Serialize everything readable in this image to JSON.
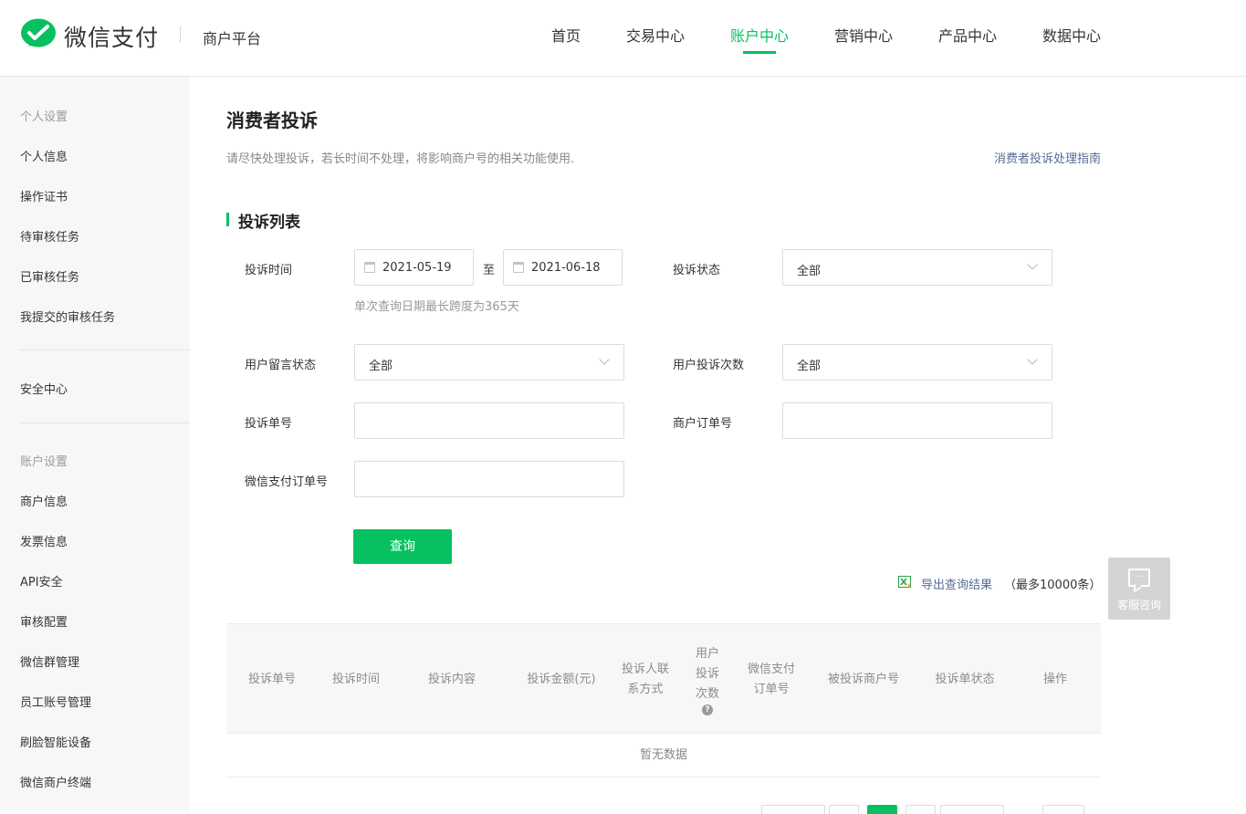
{
  "brand": {
    "name": "微信支付",
    "platform": "商户平台",
    "color": "#07c160"
  },
  "nav": {
    "items": [
      "首页",
      "交易中心",
      "账户中心",
      "营销中心",
      "产品中心",
      "数据中心"
    ],
    "active": "账户中心"
  },
  "sidebar": {
    "group_personal": "个人设置",
    "personal_items": [
      "个人信息",
      "操作证书",
      "待审核任务",
      "已审核任务",
      "我提交的审核任务"
    ],
    "security": "安全中心",
    "group_account": "账户设置",
    "account_items": [
      "商户信息",
      "发票信息",
      "API安全",
      "审核配置",
      "微信群管理",
      "员工账号管理",
      "刷脸智能设备",
      "微信商户终端"
    ]
  },
  "page": {
    "title": "消费者投诉",
    "description": "请尽快处理投诉，若长时间不处理，将影响商户号的相关功能使用.",
    "guide_link": "消费者投诉处理指南"
  },
  "filters": {
    "section_title": "投诉列表",
    "time_label": "投诉时间",
    "start_date": "2021-05-19",
    "to_label": "至",
    "end_date": "2021-06-18",
    "date_hint": "单次查询日期最长跨度为365天",
    "status_label": "投诉状态",
    "status_value": "全部",
    "message_status_label": "用户留言状态",
    "message_status_value": "全部",
    "complaint_count_label": "用户投诉次数",
    "complaint_count_value": "全部",
    "complaint_no_label": "投诉单号",
    "complaint_no_value": "",
    "merchant_order_label": "商户订单号",
    "merchant_order_value": "",
    "wxpay_order_label": "微信支付订单号",
    "wxpay_order_value": "",
    "query_button": "查询"
  },
  "export": {
    "link": "导出查询结果",
    "note": "（最多10000条）"
  },
  "table": {
    "columns": [
      "投诉单号",
      "投诉时间",
      "投诉内容",
      "投诉金额(元)",
      "投诉人联系方式",
      "用户投诉次数",
      "微信支付订单号",
      "被投诉商户号",
      "投诉单状态",
      "操作"
    ],
    "empty_text": "暂无数据",
    "help_icon": "?"
  },
  "service": {
    "label": "客服咨询",
    "icon": "chat-bubble-icon",
    "dots": "···"
  }
}
